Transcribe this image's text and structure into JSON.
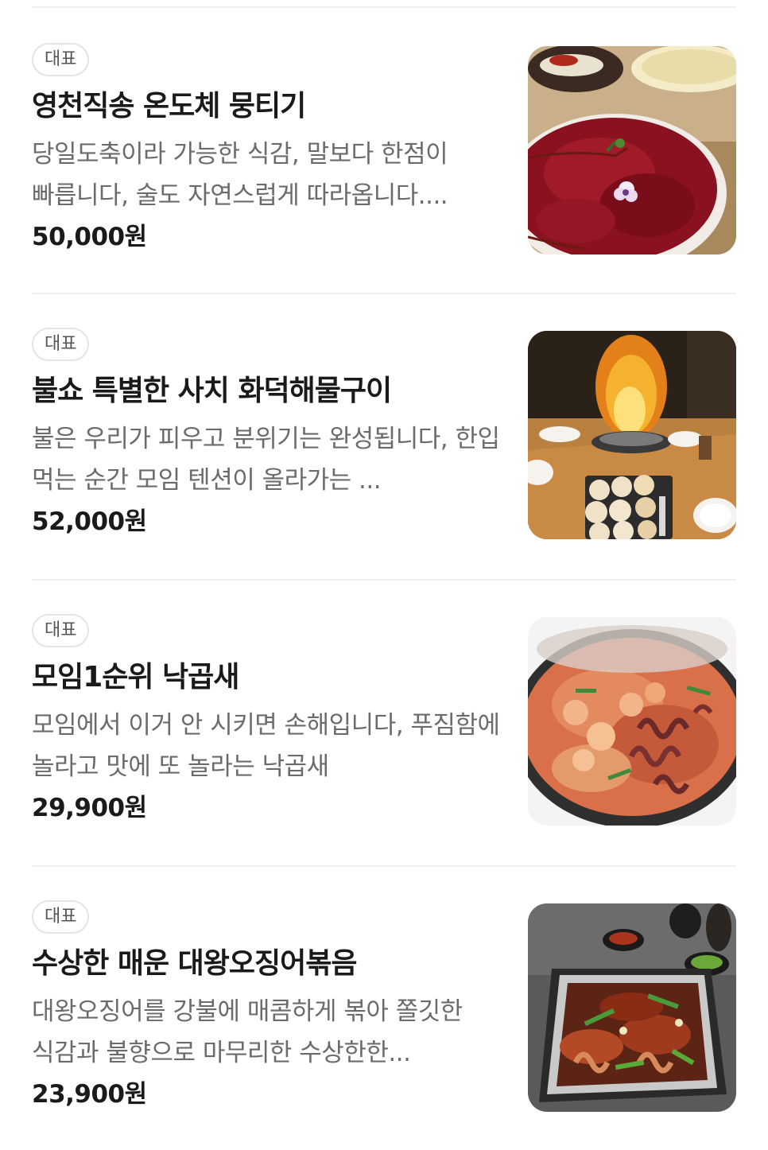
{
  "menu": {
    "items": [
      {
        "badge": "대표",
        "name": "영천직송 온도체 뭉티기",
        "description": "당일도축이라 가능한 식감, 말보다 한점이 빠릅니다, 술도 자연스럽게 따라옵니다....",
        "price": "50,000원",
        "image_icon": "raw-beef-platter-photo"
      },
      {
        "badge": "대표",
        "name": "불쇼 특별한 사치 화덕해물구이",
        "description": "불은 우리가 피우고 분위기는 완성됩니다, 한입 먹는 순간 모임 텐션이 올라가는 ...",
        "price": "52,000원",
        "image_icon": "flaming-seafood-grill-photo"
      },
      {
        "badge": "대표",
        "name": "모임1순위 낙곱새",
        "description": "모임에서 이거 안 시키면 손해입니다, 푸짐함에 놀라고 맛에 또 놀라는 낙곱새",
        "price": "29,900원",
        "image_icon": "octopus-tripe-shrimp-stew-photo"
      },
      {
        "badge": "대표",
        "name": "수상한 매운 대왕오징어볶음",
        "description": "대왕오징어를 강불에 매콤하게 볶아 쫄깃한 식감과 불향으로 마무리한 수상한한...",
        "price": "23,900원",
        "image_icon": "spicy-squid-stir-fry-photo"
      }
    ]
  }
}
